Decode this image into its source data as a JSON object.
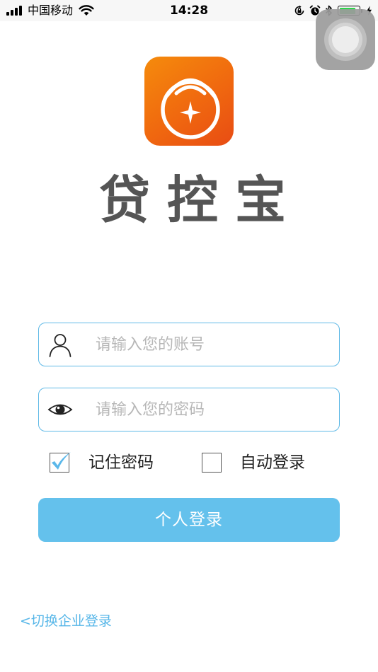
{
  "status_bar": {
    "carrier": "中国移动",
    "time": "14:28",
    "battery_level": 0.85
  },
  "brand": {
    "name": "贷控宝"
  },
  "login_form": {
    "account_placeholder": "请输入您的账号",
    "password_placeholder": "请输入您的密码",
    "remember_label": "记住密码",
    "remember_checked": true,
    "auto_login_label": "自动登录",
    "auto_login_checked": false,
    "submit_label": "个人登录"
  },
  "footer": {
    "switch_link": "<切换企业登录"
  },
  "colors": {
    "accent": "#64c1ec",
    "field_border": "#5fb9e6",
    "logo_orange": "#f0680f",
    "brand_text": "#555555"
  },
  "icons": {
    "account": "user-icon",
    "password": "eye-icon",
    "remember": "checkmark-icon"
  }
}
